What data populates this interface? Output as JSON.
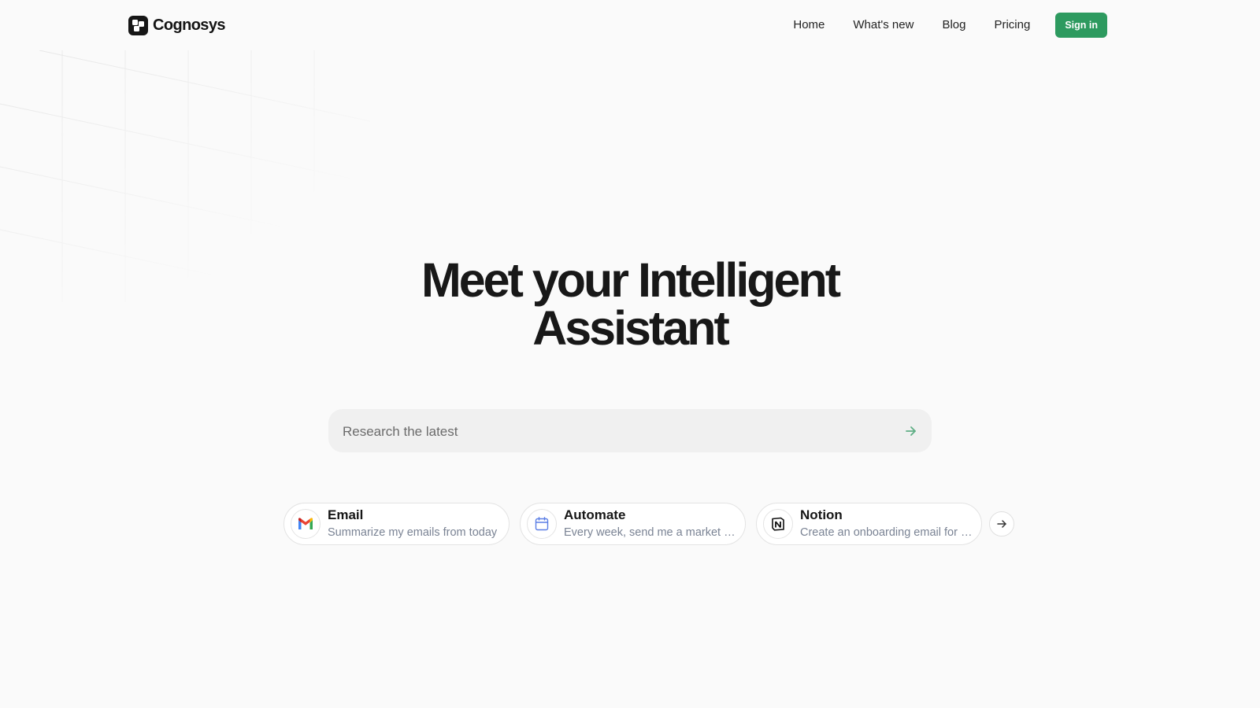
{
  "brand": {
    "name": "Cognosys"
  },
  "nav": {
    "links": [
      "Home",
      "What's new",
      "Blog",
      "Pricing"
    ],
    "signin_label": "Sign in"
  },
  "hero": {
    "title_line1": "Meet your Intelligent",
    "title_line2": "Assistant"
  },
  "search": {
    "placeholder": "Research the latest"
  },
  "suggestions": [
    {
      "icon": "gmail-icon",
      "title": "Email",
      "subtitle": "Summarize my emails from today"
    },
    {
      "icon": "calendar-icon",
      "title": "Automate",
      "subtitle": "Every week, send me a market update"
    },
    {
      "icon": "notion-icon",
      "title": "Notion",
      "subtitle": "Create an onboarding email for new hires"
    }
  ],
  "colors": {
    "accent": "#2d9a5f",
    "background": "#fafafa",
    "search_bg": "#f0f0f0",
    "subtitle": "#7a8394"
  }
}
